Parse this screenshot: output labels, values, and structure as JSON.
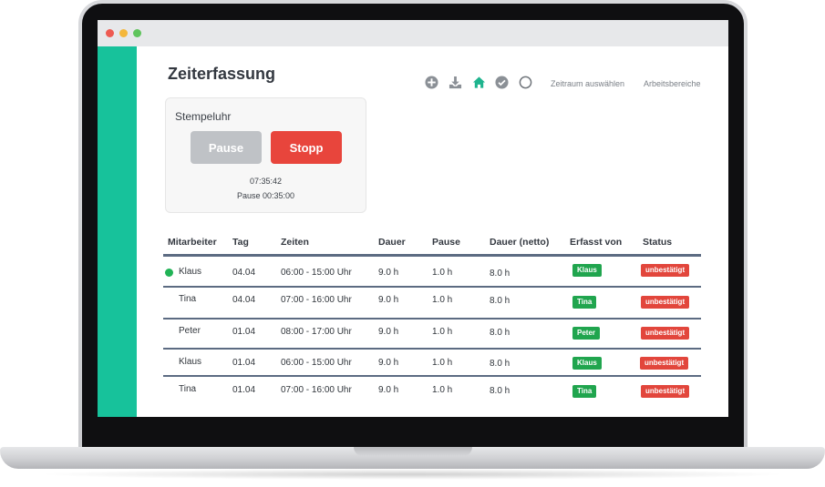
{
  "app": {
    "title": "Zeiterfassung"
  },
  "colors": {
    "sidebar": "#17c29b",
    "stop": "#e8453c",
    "pause": "#bfc2c6",
    "badge_green": "#20a54e",
    "badge_red": "#e2463c"
  },
  "toolbar": {
    "icons": [
      "plus-circle-icon",
      "download-icon",
      "home-icon",
      "check-circle-icon",
      "circle-icon"
    ],
    "zeitraum_label": "Zeitraum auswählen",
    "arbeitsbereiche_label": "Arbeitsbereiche"
  },
  "clock": {
    "title": "Stempeluhr",
    "pause_label": "Pause",
    "stop_label": "Stopp",
    "time": "07:35:42",
    "pause_time": "Pause 00:35:00"
  },
  "table": {
    "headers": [
      "Mitarbeiter",
      "Tag",
      "Zeiten",
      "Dauer",
      "Pause",
      "Dauer (netto)",
      "Erfasst von",
      "Status"
    ],
    "rows": [
      {
        "name": "Klaus",
        "online": true,
        "day": "04.04",
        "times": "06:00 - 15:00 Uhr",
        "duration": "9.0 h",
        "pause": "1.0  h",
        "net": "8.0  h",
        "by": "Klaus",
        "status": "unbestätigt"
      },
      {
        "name": "Tina",
        "online": false,
        "day": "04.04",
        "times": "07:00 - 16:00 Uhr",
        "duration": "9.0 h",
        "pause": "1.0 h",
        "net": "8.0 h",
        "by": "Tina",
        "status": "unbestätigt"
      },
      {
        "name": "Peter",
        "online": false,
        "day": "01.04",
        "times": "08:00 - 17:00 Uhr",
        "duration": "9.0 h",
        "pause": "1.0 h",
        "net": "8.0 h",
        "by": "Peter",
        "status": "unbestätigt"
      },
      {
        "name": "Klaus",
        "online": false,
        "day": "01.04",
        "times": "06:00 - 15:00 Uhr",
        "duration": "9.0 h",
        "pause": "1.0  h",
        "net": "8.0  h",
        "by": "Klaus",
        "status": "unbestätigt"
      },
      {
        "name": "Tina",
        "online": false,
        "day": "01.04",
        "times": "07:00 - 16:00 Uhr",
        "duration": "9.0 h",
        "pause": "1.0 h",
        "net": "8.0 h",
        "by": "Tina",
        "status": "unbestätigt"
      }
    ]
  }
}
